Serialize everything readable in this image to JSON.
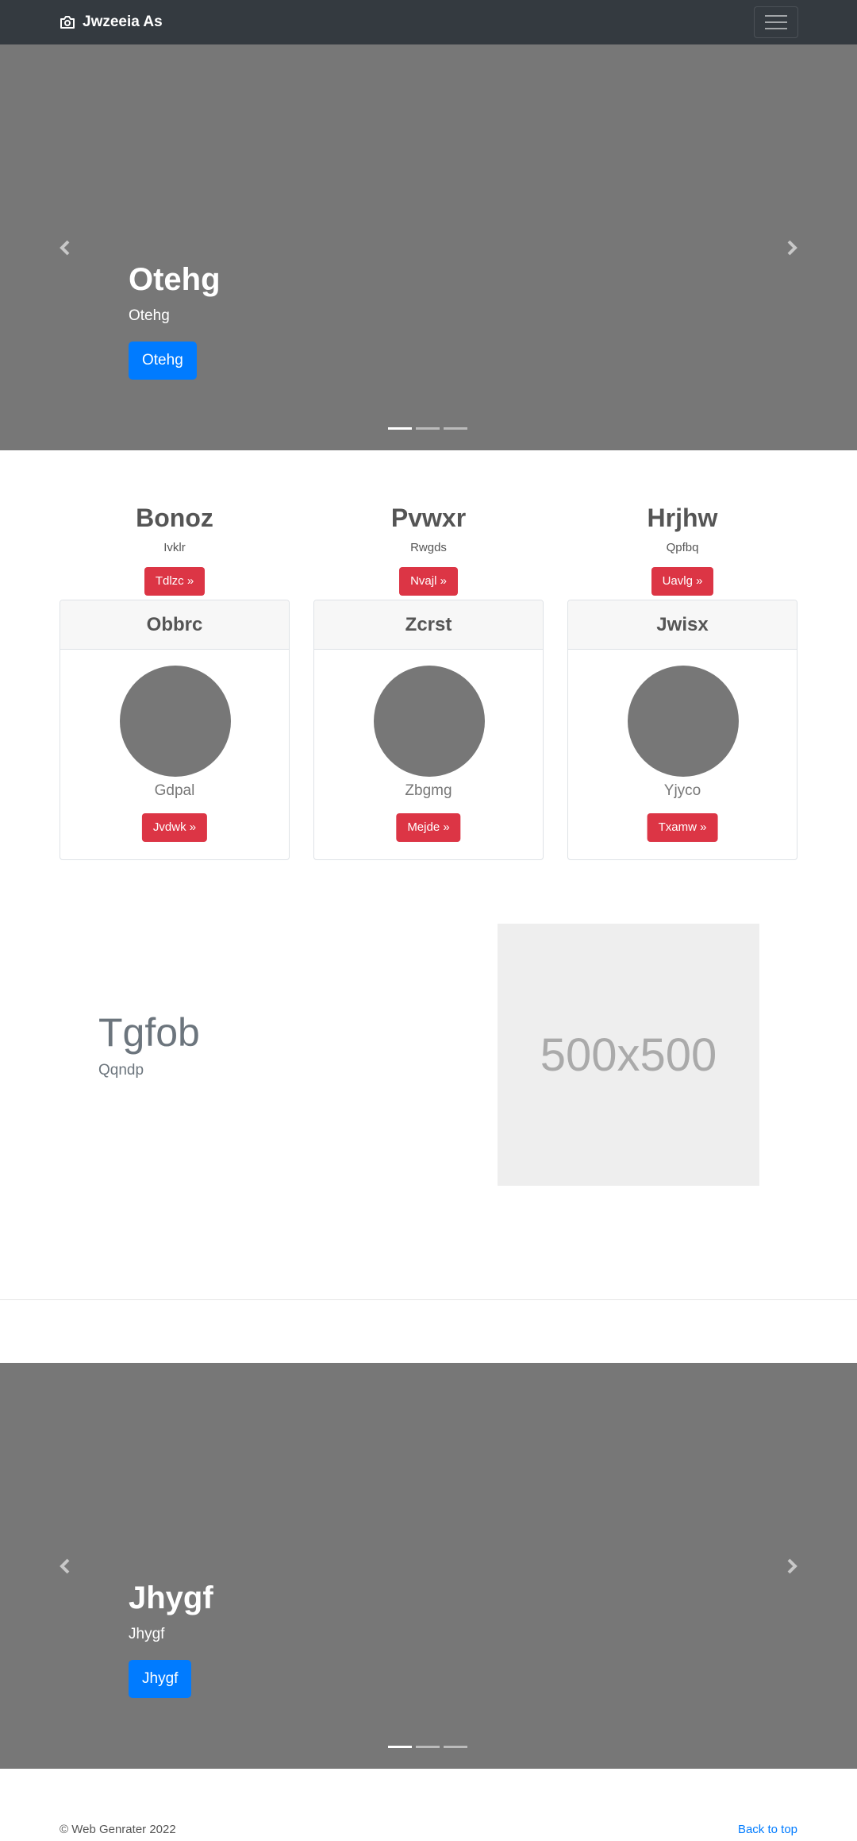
{
  "navbar": {
    "brand": "Jwzeeia As",
    "brand_icon": "camera-icon",
    "toggler_icon": "hamburger-menu-icon"
  },
  "carousel_top": {
    "title": "Otehg",
    "subtitle": "Otehg",
    "button": "Otehg",
    "prev_icon": "chevron-left-icon",
    "next_icon": "chevron-right-icon",
    "slides": 3,
    "active_slide": 1
  },
  "features": [
    {
      "title": "Bonoz",
      "subtitle": "Ivklr",
      "button": "Tdlzc »"
    },
    {
      "title": "Pvwxr",
      "subtitle": "Rwgds",
      "button": "Nvajl »"
    },
    {
      "title": "Hrjhw",
      "subtitle": "Qpfbq",
      "button": "Uavlg »"
    }
  ],
  "cards": [
    {
      "header": "Obbrc",
      "name": "Gdpal",
      "button": "Jvdwk »"
    },
    {
      "header": "Zcrst",
      "name": "Zbgmg",
      "button": "Mejde »"
    },
    {
      "header": "Jwisx",
      "name": "Yjyco",
      "button": "Txamw »"
    }
  ],
  "featurette": {
    "title": "Tgfob",
    "subtitle": "Qqndp",
    "image_text": "500x500"
  },
  "carousel_bottom": {
    "title": "Jhygf",
    "subtitle": "Jhygf",
    "button": "Jhygf",
    "prev_icon": "chevron-left-icon",
    "next_icon": "chevron-right-icon",
    "slides": 3,
    "active_slide": 1
  },
  "footer": {
    "copyright": "© Web Genrater 2022",
    "back_to_top": "Back to top"
  },
  "colors": {
    "navbar": "#343a40",
    "carousel_bg": "#777777",
    "primary": "#007bff",
    "danger": "#dc3545",
    "placeholder_bg": "#eeeeee"
  }
}
